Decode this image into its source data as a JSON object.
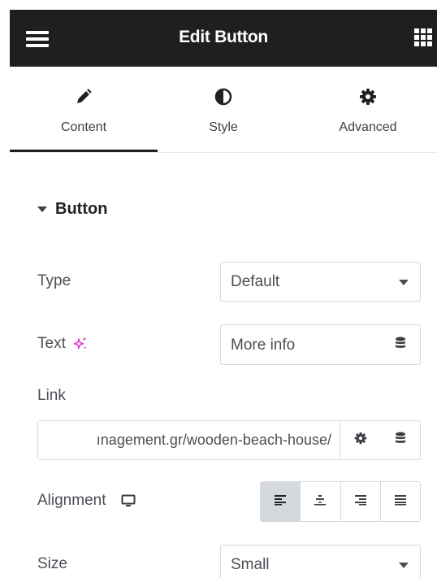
{
  "header": {
    "title": "Edit Button",
    "menu_icon": "hamburger-menu-icon",
    "apps_icon": "grid-apps-icon"
  },
  "tabs": [
    {
      "label": "Content",
      "icon": "pencil-icon",
      "active": true
    },
    {
      "label": "Style",
      "icon": "half-circle-icon",
      "active": false
    },
    {
      "label": "Advanced",
      "icon": "gear-icon",
      "active": false
    }
  ],
  "section": {
    "title": "Button",
    "expanded": true
  },
  "fields": {
    "type": {
      "label": "Type",
      "value": "Default"
    },
    "text": {
      "label": "Text",
      "value": "More info",
      "ai_icon": "sparkle-ai-icon"
    },
    "link": {
      "label": "Link",
      "value": "ınagement.gr/wooden-beach-house/"
    },
    "alignment": {
      "label": "Alignment",
      "device_icon": "desktop-monitor-icon",
      "options": [
        "left",
        "center",
        "right",
        "justify"
      ],
      "selected": "left"
    },
    "size": {
      "label": "Size",
      "value": "Small"
    }
  },
  "colors": {
    "topbar_bg": "#1f1f1f",
    "ai_accent": "#e53ad0",
    "active_align_bg": "#d5d8dc"
  }
}
